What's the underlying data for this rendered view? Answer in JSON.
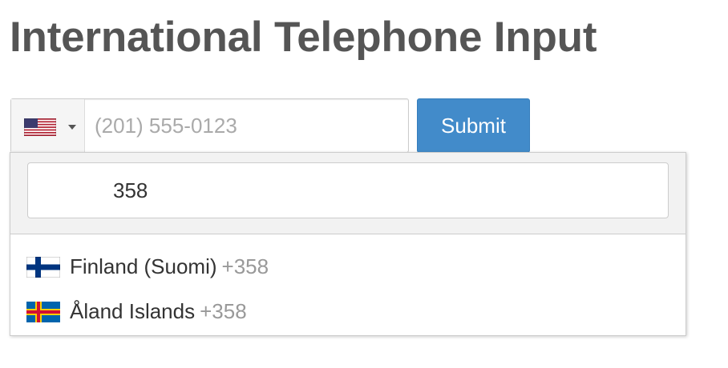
{
  "page": {
    "title": "International Telephone Input"
  },
  "phone_input": {
    "selected_country_flag": "us-flag-icon",
    "placeholder": "(201) 555-0123",
    "value": ""
  },
  "submit_button": {
    "label": "Submit",
    "color": "#428bca"
  },
  "country_dropdown": {
    "search": {
      "value": "358"
    },
    "countries": [
      {
        "name": "Finland (Suomi)",
        "dial_code": "+358",
        "flag_icon": "finland-flag-icon"
      },
      {
        "name": "Åland Islands",
        "dial_code": "+358",
        "flag_icon": "aland-islands-flag-icon"
      }
    ]
  }
}
